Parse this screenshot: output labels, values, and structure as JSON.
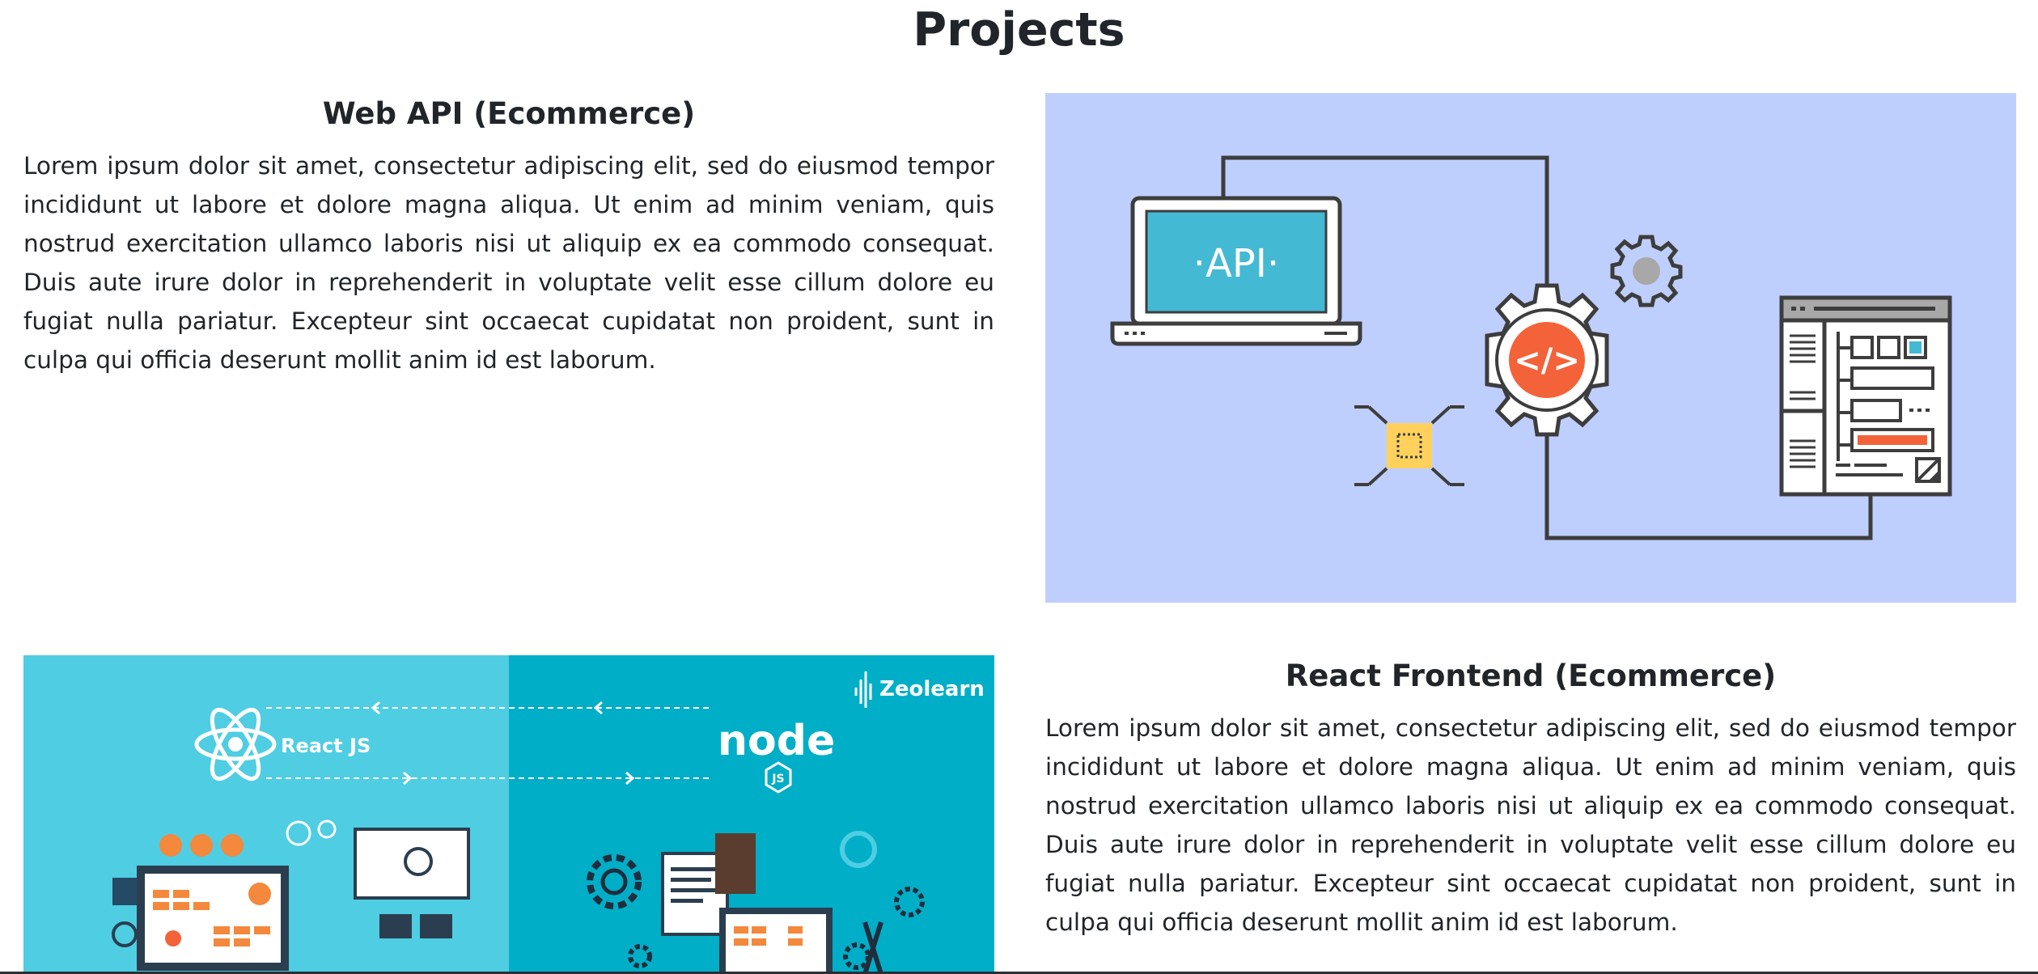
{
  "page": {
    "title": "Projects"
  },
  "projects": [
    {
      "title": "Web API (Ecommerce)",
      "description": "Lorem ipsum dolor sit amet, consectetur adipiscing elit, sed do eiusmod tempor incididunt ut labore et dolore magna aliqua. Ut enim ad minim veniam, quis nostrud exercitation ullamco laboris nisi ut aliquip ex ea commodo consequat. Duis aute irure dolor in reprehenderit in voluptate velit esse cillum dolore eu fugiat nulla pariatur. Excepteur sint occaecat cupidatat non proident, sunt in culpa qui officia deserunt mollit anim id est laborum.",
      "image": {
        "laptop_text": "·API·",
        "bg_color": "#bfcffd",
        "accent": "#f4623a"
      }
    },
    {
      "title": "React Frontend (Ecommerce)",
      "description": "Lorem ipsum dolor sit amet, consectetur adipiscing elit, sed do eiusmod tempor incididunt ut labore et dolore magna aliqua. Ut enim ad minim veniam, quis nostrud exercitation ullamco laboris nisi ut aliquip ex ea commodo consequat. Duis aute irure dolor in reprehenderit in voluptate velit esse cillum dolore eu fugiat nulla pariatur. Excepteur sint occaecat cupidatat non proident, sunt in culpa qui officia deserunt mollit anim id est laborum.",
      "image": {
        "brand": "Zeolearn",
        "left_label": "React JS",
        "right_logo": "node",
        "right_logo_sub": "JS",
        "left_bg": "#4fcde2",
        "right_bg": "#00aec7"
      }
    }
  ]
}
